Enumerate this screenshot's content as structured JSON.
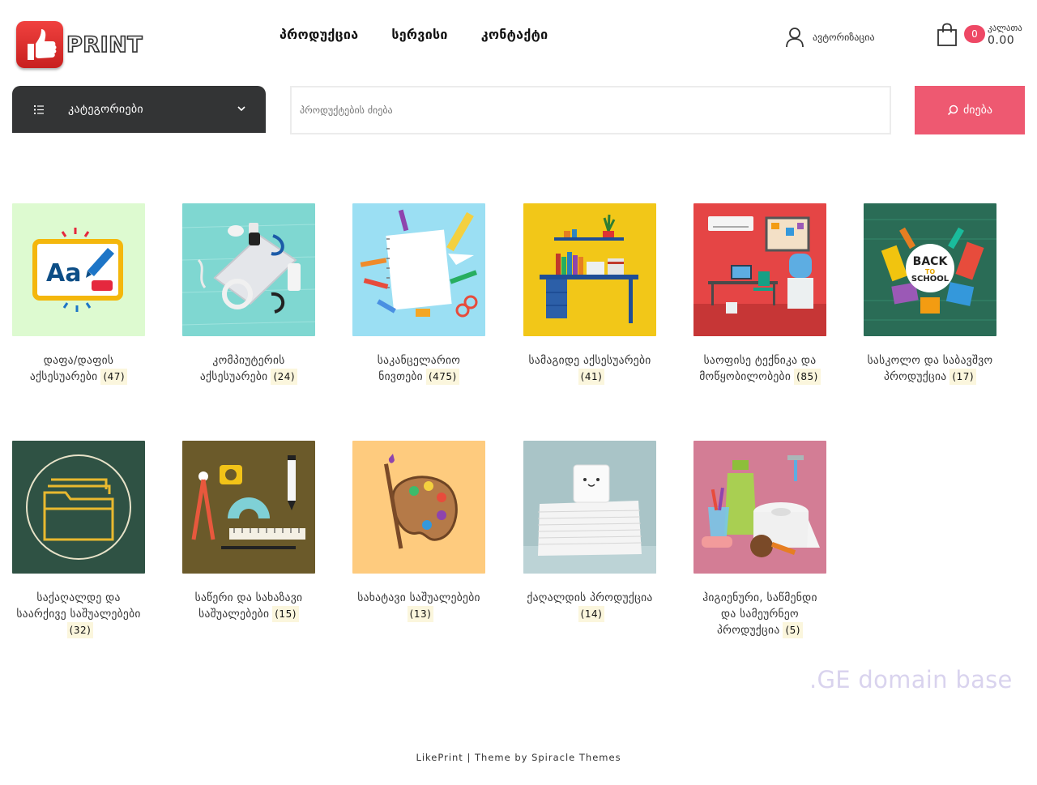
{
  "header": {
    "logo_text": "PRINT",
    "nav": [
      {
        "label": "პროდუქცია"
      },
      {
        "label": "სერვისი"
      },
      {
        "label": "კონტაქტი"
      }
    ],
    "account_label": "ავტორიზაცია",
    "cart": {
      "count": "0",
      "label": "კალათა",
      "total": "0.00"
    }
  },
  "categories_bar": {
    "label": "კატეგორიები"
  },
  "search": {
    "placeholder": "პროდუქტების ძიება",
    "button_label": "ძიება"
  },
  "categories": [
    {
      "name": "დაფა/დაფის აქსესუარები",
      "count": "(47)",
      "icon": "whiteboard-icon"
    },
    {
      "name": "კომპიუტერის აქსესუარები",
      "count": "(24)",
      "icon": "laptop-accessories-icon"
    },
    {
      "name": "საკანცელარიო ნივთები",
      "count": "(475)",
      "icon": "notepad-stationery-icon"
    },
    {
      "name": "სამაგიდე აქსესუარები",
      "count": "(41)",
      "icon": "desk-icon"
    },
    {
      "name": "საოფისე ტექნიკა და მოწყობილობები",
      "count": "(85)",
      "icon": "office-room-icon"
    },
    {
      "name": "სასკოლო და საბავშვო პროდუქცია",
      "count": "(17)",
      "icon": "back-to-school-icon"
    },
    {
      "name": "საქაღალდე და საარქივე საშუალებები",
      "count": "(32)",
      "icon": "folder-icon"
    },
    {
      "name": "საწერი და სახაზავი საშუალებები",
      "count": "(15)",
      "icon": "drawing-tools-icon"
    },
    {
      "name": "სახატავი საშუალებები",
      "count": "(13)",
      "icon": "paint-palette-icon"
    },
    {
      "name": "ქაღალდის პროდუქცია",
      "count": "(14)",
      "icon": "paper-stack-icon"
    },
    {
      "name": "ჰიგიენური, საწმენდი და სამეურნეო პროდუქცია",
      "count": "(5)",
      "icon": "hygiene-icon"
    }
  ],
  "watermark": ".GE domain base",
  "footer": "LikePrint | Theme by Spiracle Themes",
  "colors": {
    "accent": "#ee5971",
    "dark_bar": "#333435",
    "badge_bg": "#fbf6dd"
  }
}
